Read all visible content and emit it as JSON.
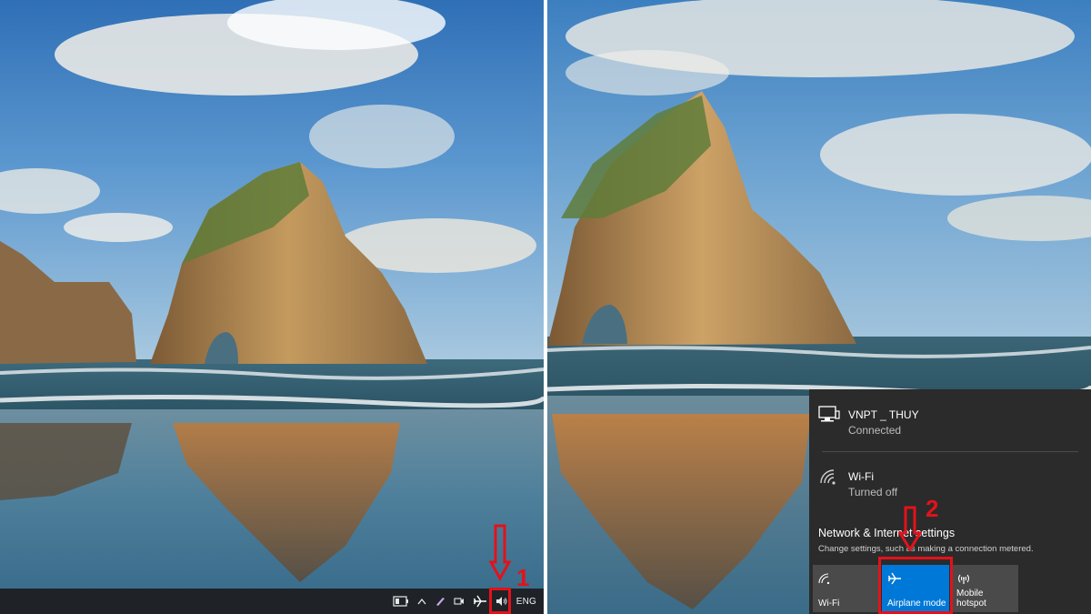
{
  "left_screen": {
    "taskbar": {
      "tray_icons": [
        "battery-icon",
        "chevron-up-icon",
        "pen-icon",
        "camera-icon",
        "airplane-icon",
        "speaker-icon"
      ],
      "language": "ENG"
    },
    "annotation": {
      "step": "1",
      "color": "#e3121a"
    }
  },
  "right_screen": {
    "network_flyout": {
      "networks": [
        {
          "name": "VNPT _ THUY",
          "status": "Connected",
          "icon": "ethernet-icon"
        },
        {
          "name": "Wi-Fi",
          "status": "Turned off",
          "icon": "wifi-icon"
        }
      ],
      "settings_title": "Network & Internet settings",
      "settings_subtitle": "Change settings, such as making a connection metered.",
      "quick_actions": [
        {
          "label": "Wi-Fi",
          "icon": "wifi-icon",
          "active": false
        },
        {
          "label": "Airplane mode",
          "icon": "airplane-icon",
          "active": true
        },
        {
          "label": "Mobile hotspot",
          "icon": "hotspot-icon",
          "active": false
        }
      ],
      "accent_color": "#0078d7"
    },
    "annotation": {
      "step": "2",
      "color": "#e3121a"
    }
  }
}
